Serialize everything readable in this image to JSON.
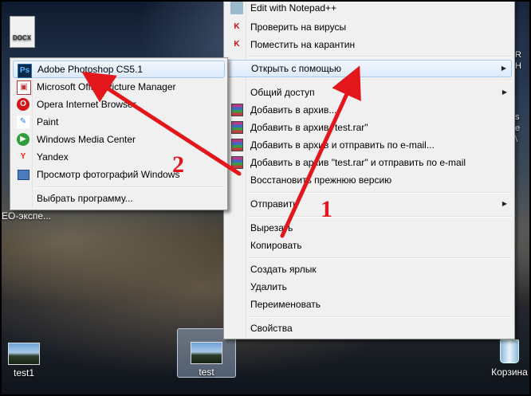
{
  "desktop": {
    "left_icons": {
      "docx_label": "DOCX",
      "edge_label_1": "EO-экспе..."
    },
    "right_edge_texts": [
      "R",
      "H",
      "s",
      "e",
      "\\",
      "e"
    ],
    "icons": [
      {
        "label": "test1"
      },
      {
        "label": "test"
      },
      {
        "label": "Корзина"
      }
    ]
  },
  "context_menu": {
    "items": [
      {
        "label": "Edit with Notepad++",
        "icon": "notepad-icon"
      },
      {
        "label": "Проверить на вирусы",
        "icon": "kaspersky-icon"
      },
      {
        "label": "Поместить на карантин",
        "icon": "kaspersky-icon"
      },
      {
        "label": "Открыть с помощью",
        "icon": "",
        "submenu": true
      },
      {
        "label": "Общий доступ",
        "icon": "",
        "submenu": true
      },
      {
        "label": "Добавить в архив...",
        "icon": "winrar-icon"
      },
      {
        "label": "Добавить в архив \"test.rar\"",
        "icon": "winrar-icon"
      },
      {
        "label": "Добавить в архив и отправить по e-mail...",
        "icon": "winrar-icon"
      },
      {
        "label": "Добавить в архив \"test.rar\" и отправить по e-mail",
        "icon": "winrar-icon"
      },
      {
        "label": "Восстановить прежнюю версию",
        "icon": ""
      },
      {
        "label": "Отправить",
        "icon": "",
        "submenu": true
      },
      {
        "label": "Вырезать",
        "icon": ""
      },
      {
        "label": "Копировать",
        "icon": ""
      },
      {
        "label": "Создать ярлык",
        "icon": ""
      },
      {
        "label": "Удалить",
        "icon": ""
      },
      {
        "label": "Переименовать",
        "icon": ""
      },
      {
        "label": "Свойства",
        "icon": ""
      }
    ]
  },
  "open_with_submenu": {
    "items": [
      {
        "label": "Adobe Photoshop CS5.1",
        "icon": "photoshop-icon",
        "icon_text": "Ps"
      },
      {
        "label": "Microsoft Office Picture Manager",
        "icon": "picture-manager-icon"
      },
      {
        "label": "Opera Internet Browser",
        "icon": "opera-icon",
        "icon_text": "O"
      },
      {
        "label": "Paint",
        "icon": "paint-icon"
      },
      {
        "label": "Windows Media Center",
        "icon": "media-center-icon"
      },
      {
        "label": "Yandex",
        "icon": "yandex-icon",
        "icon_text": "Y"
      },
      {
        "label": "Просмотр фотографий Windows",
        "icon": "photo-viewer-icon"
      },
      {
        "label": "Выбрать программу...",
        "icon": ""
      }
    ]
  },
  "annotations": {
    "number_1": "1",
    "number_2": "2",
    "arrow_color": "#e3161c"
  }
}
